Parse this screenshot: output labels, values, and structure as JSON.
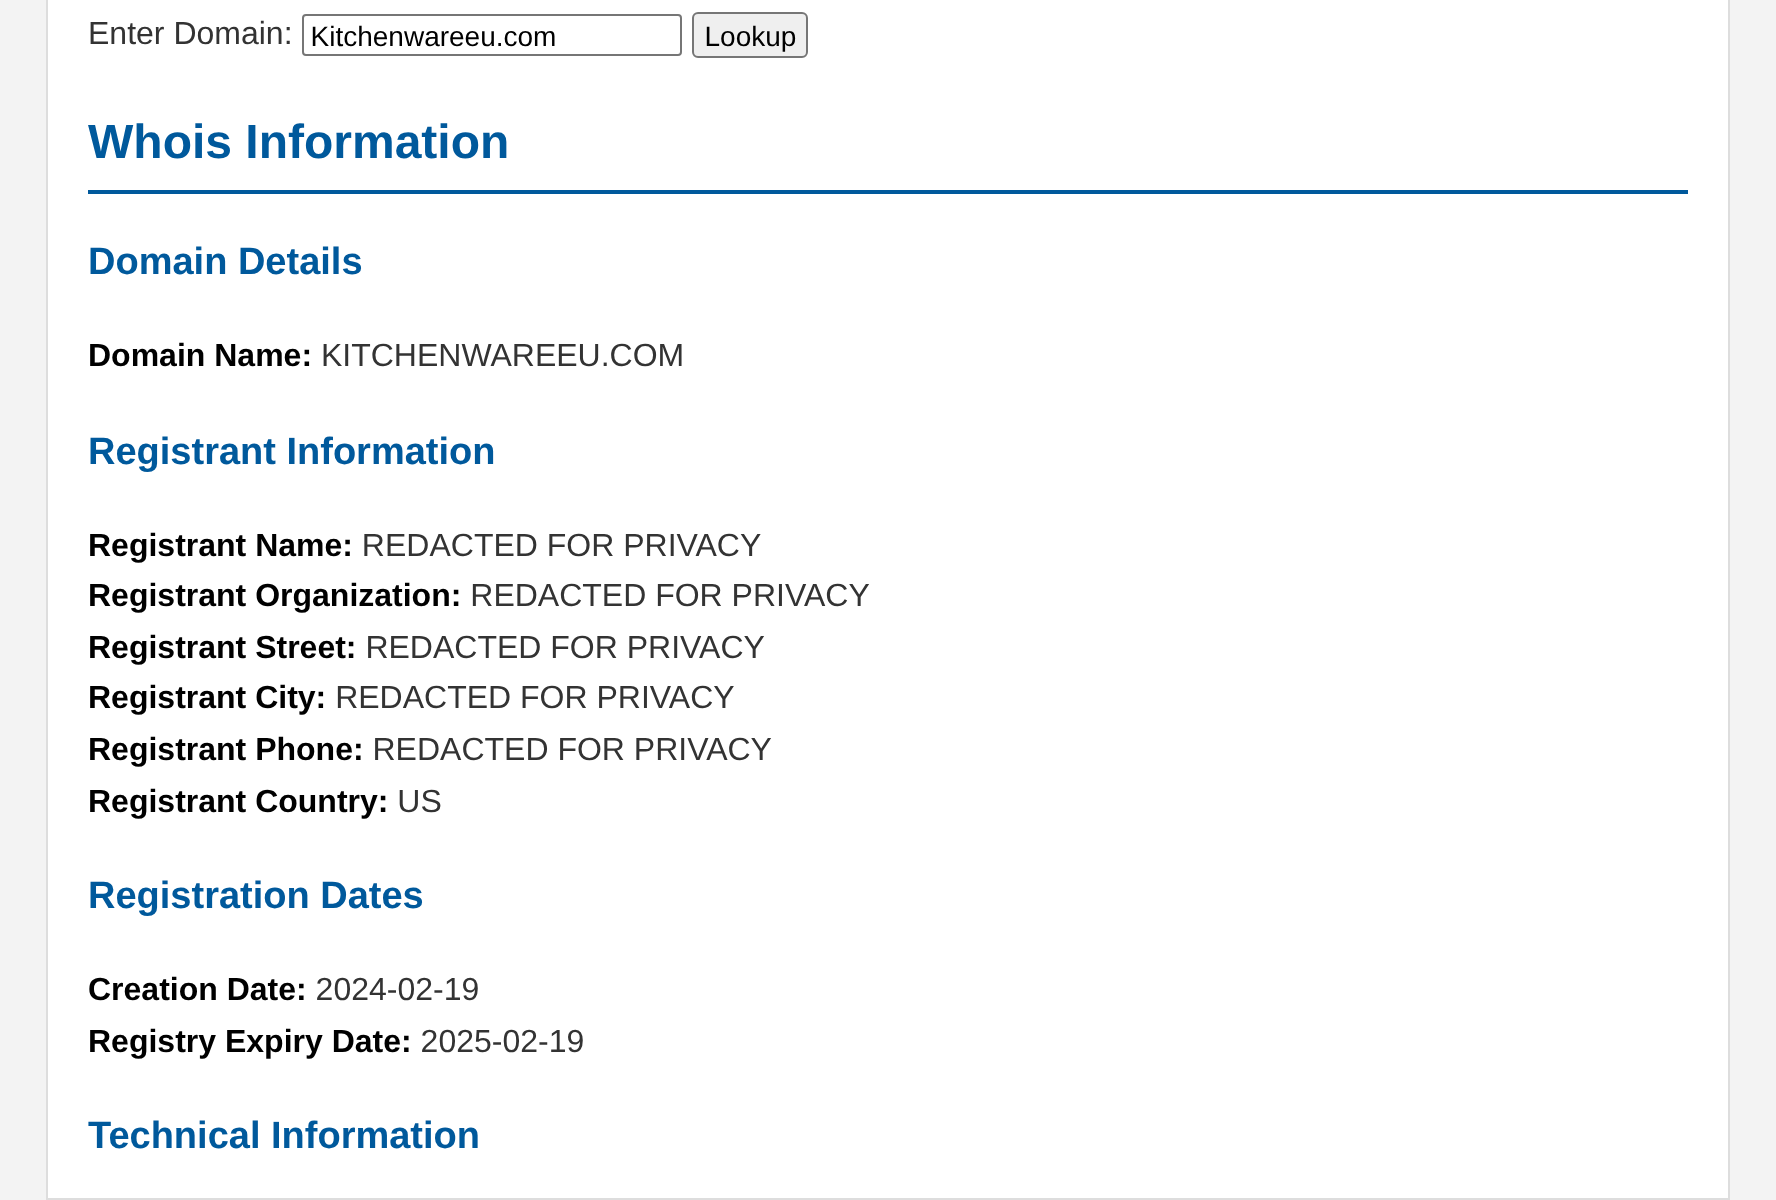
{
  "lookup": {
    "label": "Enter Domain:",
    "value": "Kitchenwareeu.com",
    "button": "Lookup"
  },
  "title": "Whois Information",
  "sections": [
    {
      "heading": "Domain Details",
      "fields": [
        "**Domain Name:** KITCHENWAREEU.COM"
      ]
    },
    {
      "heading": "Registrant Information",
      "fields": [
        "**Registrant Name:** REDACTED FOR PRIVACY",
        "**Registrant Organization:** REDACTED FOR PRIVACY",
        "**Registrant Street:** REDACTED FOR PRIVACY",
        "**Registrant City:** REDACTED FOR PRIVACY",
        "**Registrant Phone:** REDACTED FOR PRIVACY",
        "**Registrant Country:** US"
      ]
    },
    {
      "heading": "Registration Dates",
      "fields": [
        "**Creation Date:** 2024-02-19",
        "**Registry Expiry Date:** 2025-02-19"
      ]
    },
    {
      "heading": "Technical Information"
    }
  ]
}
